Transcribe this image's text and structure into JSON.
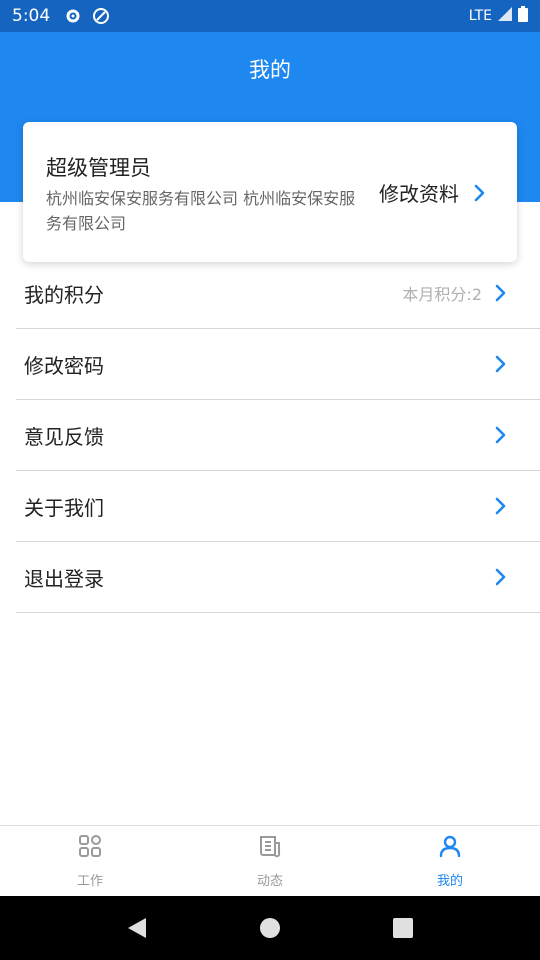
{
  "status_bar": {
    "time": "5:04",
    "network": "LTE"
  },
  "header": {
    "title": "我的"
  },
  "profile": {
    "name": "超级管理员",
    "company": "杭州临安保安服务有限公司 杭州临安保安服务有限公司",
    "edit_label": "修改资料"
  },
  "menu": {
    "items": [
      {
        "label": "我的积分",
        "value": "本月积分:2"
      },
      {
        "label": "修改密码"
      },
      {
        "label": "意见反馈"
      },
      {
        "label": "关于我们"
      },
      {
        "label": "退出登录"
      }
    ]
  },
  "tabbar": {
    "tabs": [
      {
        "label": "工作",
        "icon": "grid-icon"
      },
      {
        "label": "动态",
        "icon": "news-icon"
      },
      {
        "label": "我的",
        "icon": "user-icon",
        "active": true
      }
    ]
  },
  "colors": {
    "primary": "#1e88f0",
    "status_bar": "#1565c0",
    "chevron": "#1e88f0"
  }
}
